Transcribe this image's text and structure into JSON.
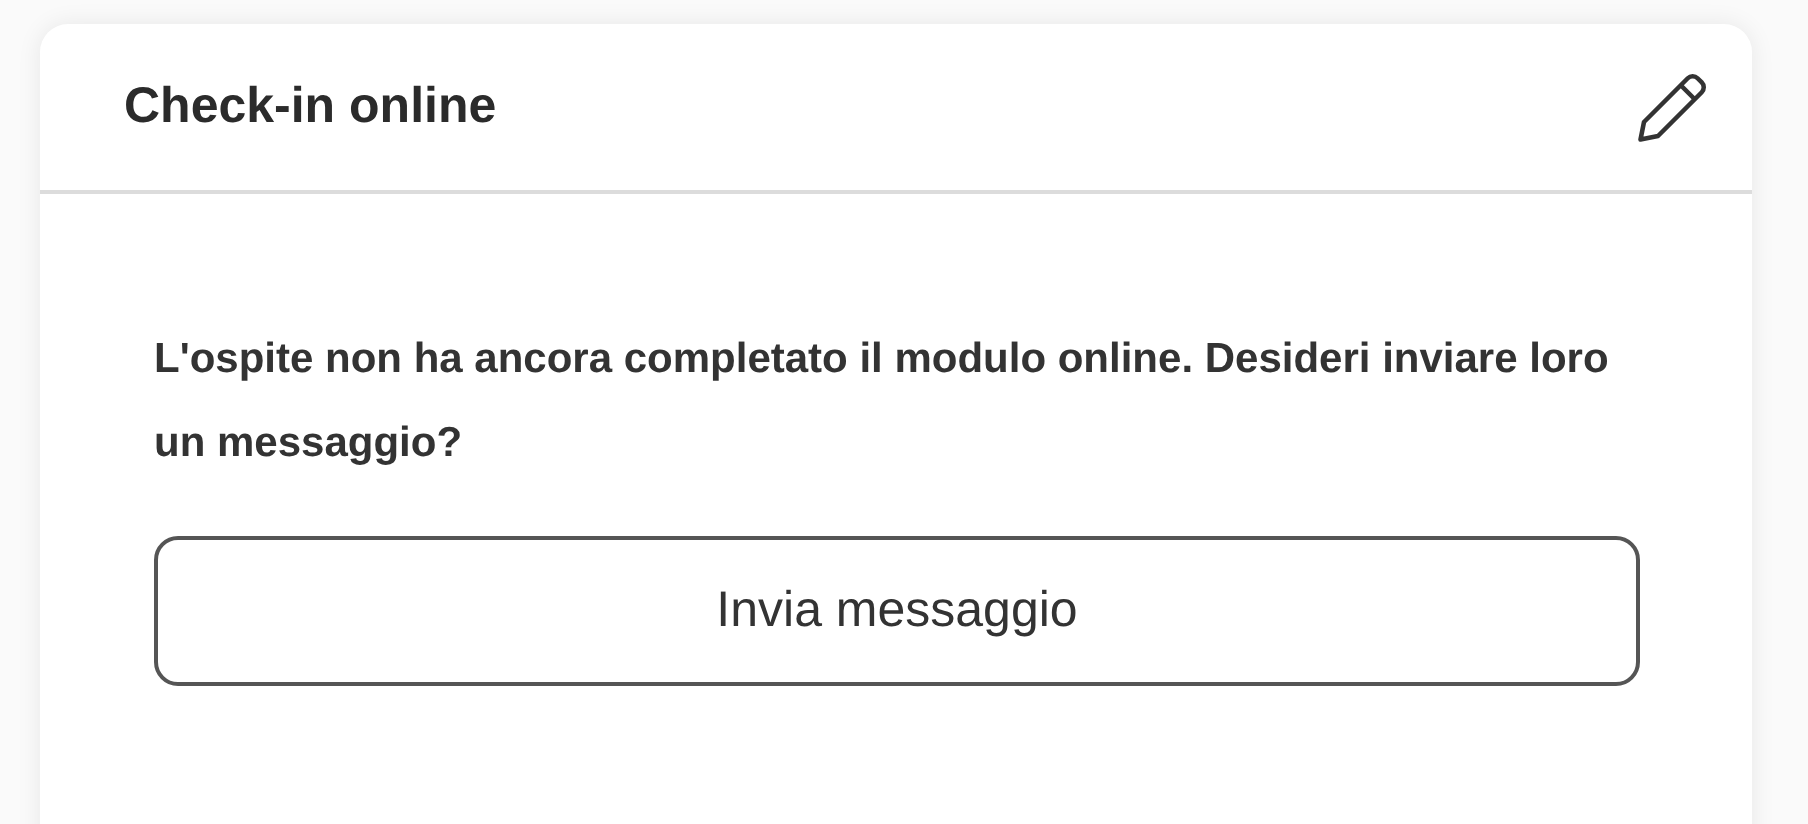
{
  "card": {
    "title": "Check-in online",
    "message": "L'ospite non ha ancora completato il modulo online. Desideri inviare loro un messaggio?",
    "button": "Invia messaggio"
  }
}
